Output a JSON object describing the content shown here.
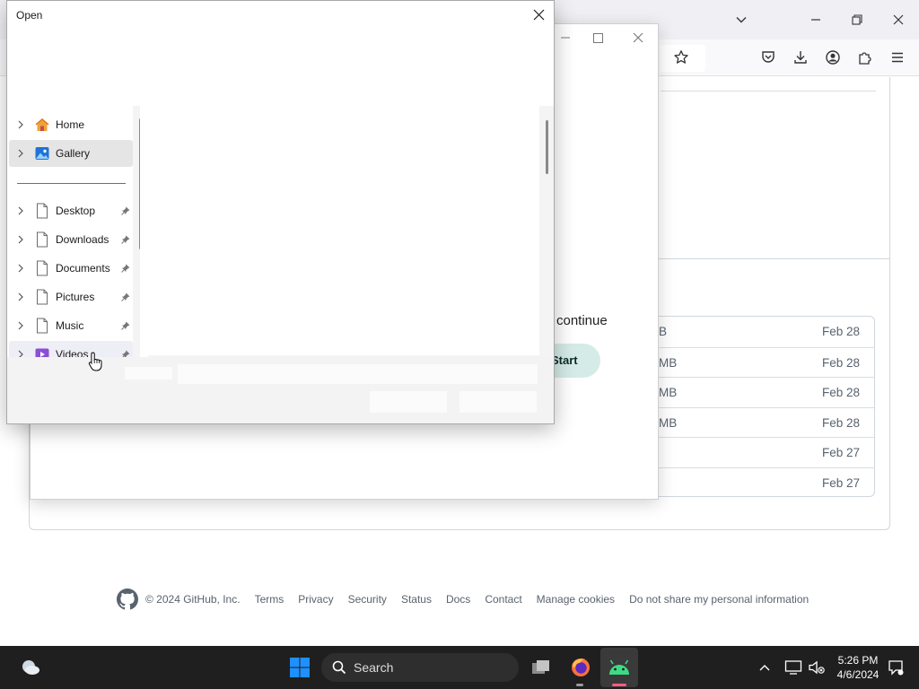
{
  "browser": {
    "window_buttons": [
      "list-tabs",
      "minimize",
      "restore",
      "close"
    ],
    "toolbar_icons": [
      "bookmark-star",
      "pocket",
      "downloads",
      "account",
      "extensions",
      "menu"
    ]
  },
  "github": {
    "assets": [
      {
        "size": "B",
        "date": "Feb 28"
      },
      {
        "size": "MB",
        "date": "Feb 28"
      },
      {
        "size": "MB",
        "date": "Feb 28"
      },
      {
        "size": "MB",
        "date": "Feb 28"
      },
      {
        "size": "",
        "date": "Feb 27"
      },
      {
        "size": "",
        "date": "Feb 27"
      }
    ],
    "footer": {
      "copyright": "© 2024 GitHub, Inc.",
      "links": [
        "Terms",
        "Privacy",
        "Security",
        "Status",
        "Docs",
        "Contact",
        "Manage cookies",
        "Do not share my personal information"
      ]
    }
  },
  "mid_dialog": {
    "continue_text": "continue",
    "start_label": "Start"
  },
  "open_dialog": {
    "title": "Open",
    "nav_items": [
      {
        "label": "Home",
        "icon": "home-icon"
      },
      {
        "label": "Gallery",
        "icon": "gallery-icon",
        "selected": true
      },
      {
        "label": "Desktop",
        "icon": "document-icon",
        "pinned": true
      },
      {
        "label": "Downloads",
        "icon": "document-icon",
        "pinned": true
      },
      {
        "label": "Documents",
        "icon": "document-icon",
        "pinned": true
      },
      {
        "label": "Pictures",
        "icon": "document-icon",
        "pinned": true
      },
      {
        "label": "Music",
        "icon": "document-icon",
        "pinned": true
      },
      {
        "label": "Videos",
        "icon": "videos-icon",
        "pinned": true
      }
    ]
  },
  "taskbar": {
    "search_placeholder": "Search",
    "time": "5:26 PM",
    "date": "4/6/2024"
  },
  "colors": {
    "taskbar": "#1f1f1f",
    "start_button_bg": "#d5ebe7",
    "selection": "#e5e5e5",
    "windows_blue": "#0078d4"
  }
}
